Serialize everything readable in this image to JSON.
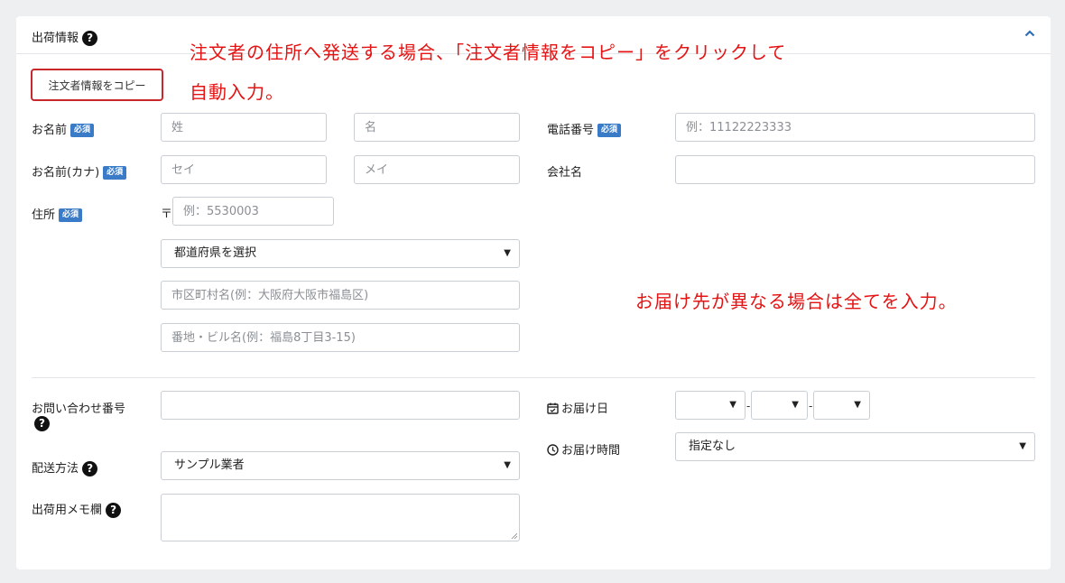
{
  "section": {
    "title": "出荷情報",
    "help_symbol": "?"
  },
  "copy_button": {
    "label": "注文者情報をコピー"
  },
  "annotations": {
    "line1": "注文者の住所へ発送する場合、「注文者情報をコピー」をクリックして",
    "line2": "自動入力。",
    "line3": "お届け先が異なる場合は全てを入力。"
  },
  "required_badge": "必須",
  "name": {
    "label": "お名前",
    "last_placeholder": "姓",
    "first_placeholder": "名"
  },
  "kana": {
    "label": "お名前(カナ)",
    "last_placeholder": "セイ",
    "first_placeholder": "メイ"
  },
  "address": {
    "label": "住所",
    "postal_mark": "〒",
    "postal_placeholder": "例：5530003",
    "prefecture_selected": "都道府県を選択",
    "city_placeholder": "市区町村名(例：大阪府大阪市福島区)",
    "street_placeholder": "番地・ビル名(例：福島8丁目3-15)"
  },
  "phone": {
    "label": "電話番号",
    "placeholder": "例：11122223333"
  },
  "company": {
    "label": "会社名"
  },
  "inquiry": {
    "label": "お問い合わせ番号"
  },
  "shipping_method": {
    "label": "配送方法",
    "selected": "サンプル業者"
  },
  "memo": {
    "label": "出荷用メモ欄"
  },
  "delivery_date": {
    "label": "お届け日",
    "separator": "-"
  },
  "delivery_time": {
    "label": "お届け時間",
    "selected": "指定なし"
  },
  "select_arrow": "▼"
}
